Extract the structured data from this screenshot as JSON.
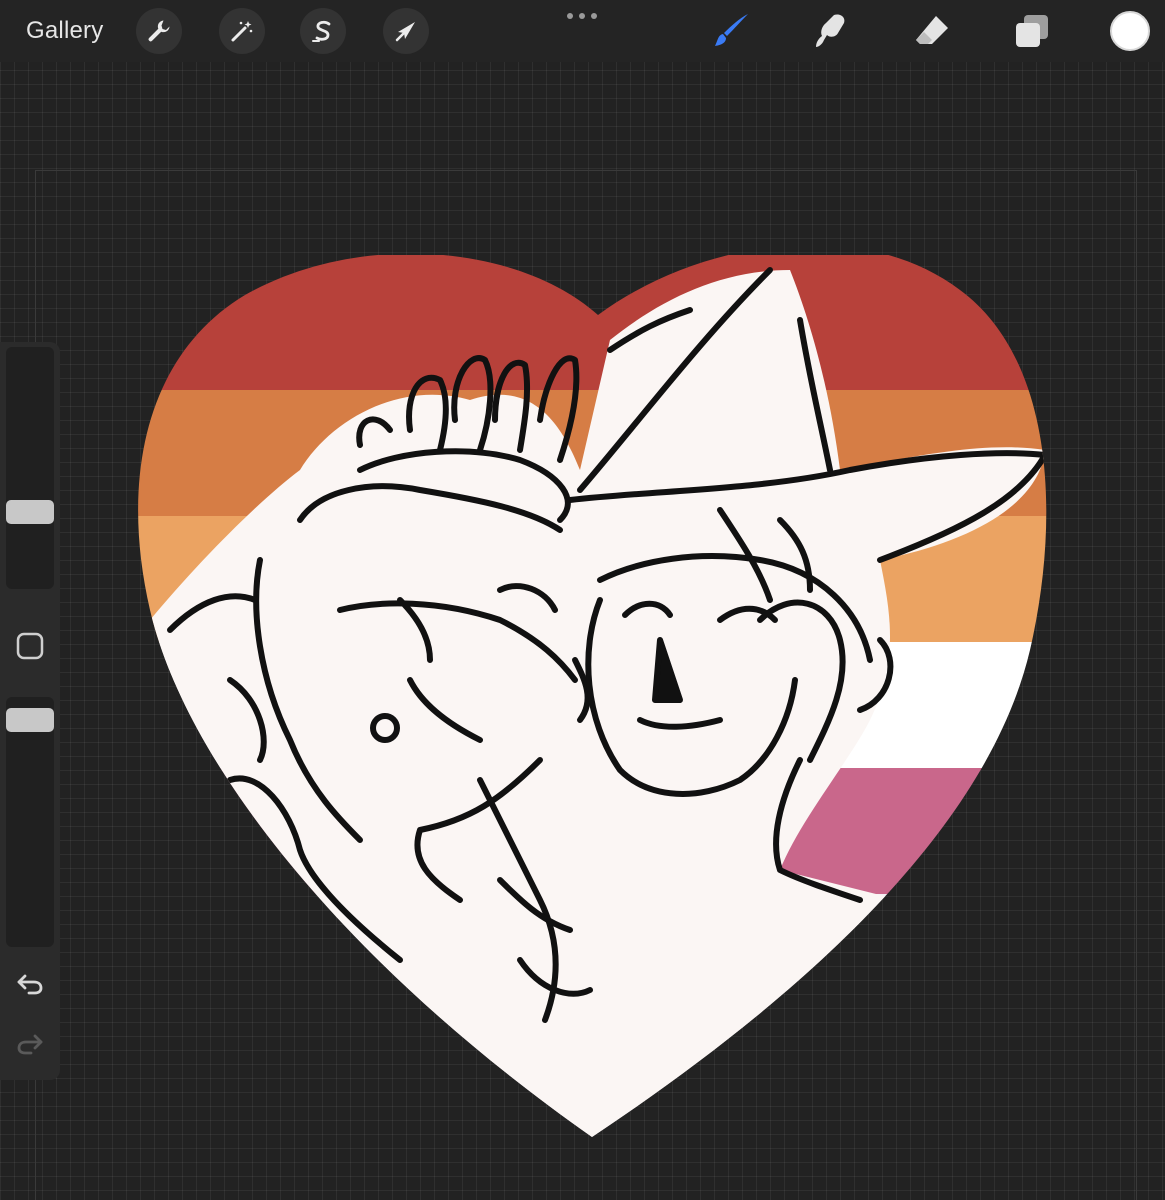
{
  "toolbar": {
    "gallery_label": "Gallery",
    "left_tools": [
      {
        "name": "actions",
        "icon": "wrench-icon"
      },
      {
        "name": "adjustments",
        "icon": "magic-wand-icon"
      },
      {
        "name": "selection",
        "icon": "selection-s-icon"
      },
      {
        "name": "transform",
        "icon": "cursor-arrow-icon"
      }
    ],
    "more_icon": "more-dots-icon",
    "right_tools": [
      {
        "name": "brush",
        "icon": "brush-icon",
        "active": true
      },
      {
        "name": "smudge",
        "icon": "smudge-icon",
        "active": false
      },
      {
        "name": "eraser",
        "icon": "eraser-icon",
        "active": false
      },
      {
        "name": "layers",
        "icon": "layers-icon",
        "active": false
      }
    ],
    "current_color": "#ffffff",
    "active_tool_color": "#3a7bf5"
  },
  "sidebar": {
    "brush_size_level": 0.3,
    "opacity_level": 0.95,
    "modify_button_icon": "square-icon",
    "undo_icon": "undo-icon",
    "redo_icon": "redo-icon"
  },
  "canvas": {
    "flag_colors": [
      "#b7413a",
      "#d67d45",
      "#eba362",
      "#ffffff",
      "#c9678b"
    ],
    "background": "#222222"
  }
}
